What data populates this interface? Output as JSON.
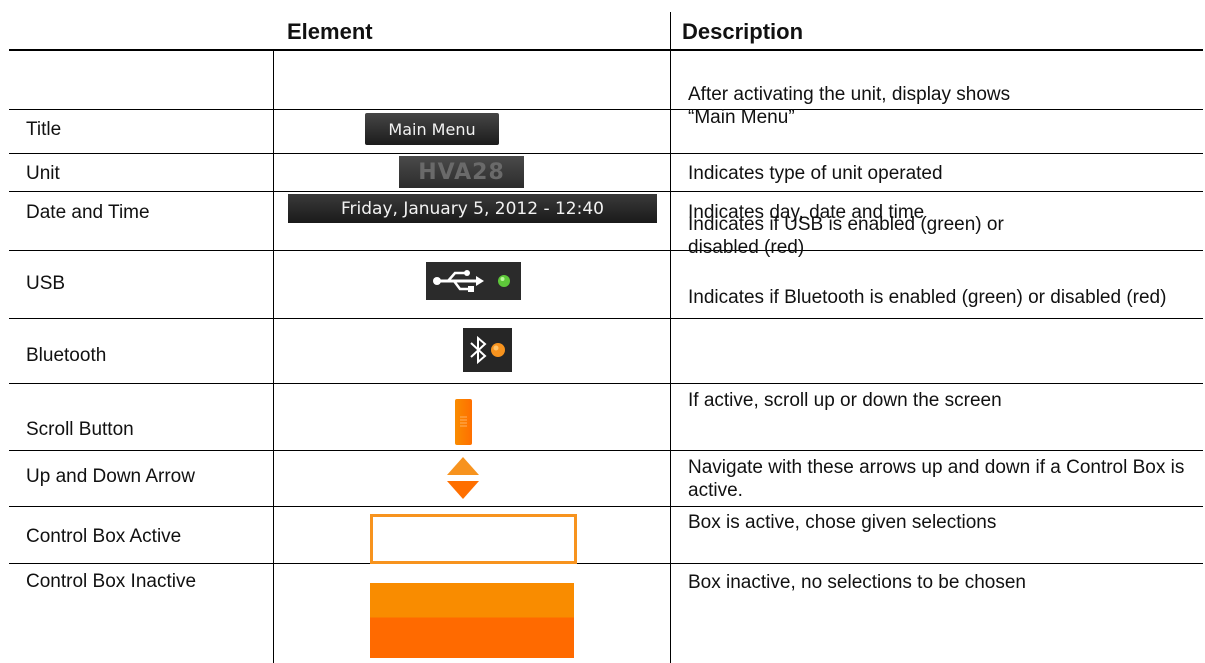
{
  "table": {
    "header": {
      "element": "Element",
      "description": "Description"
    },
    "rows": [
      {
        "element": "Title",
        "description": "After activating the unit, display shows “Main Menu”",
        "icon": "title-bar-icon",
        "icon_text": "Main Menu"
      },
      {
        "element": "Unit",
        "description": "Indicates type of unit operated",
        "icon": "unit-label-icon",
        "icon_text": "HVA28"
      },
      {
        "element": "Date and Time",
        "description": "Indicates day, date and time",
        "icon": "date-time-bar-icon",
        "icon_text": "Friday, January 5, 2012 - 12:40"
      },
      {
        "element": "USB",
        "description": "Indicates if USB is enabled (green) or disabled (red)",
        "icon": "usb-status-icon",
        "status_color": "#5ec83a"
      },
      {
        "element": "Bluetooth",
        "description": "Indicates if Bluetooth  is enabled (green) or disabled (red)",
        "icon": "bluetooth-status-icon",
        "status_color": "#f7931e"
      },
      {
        "element": "Scroll Button",
        "description": "If active, scroll up or down the screen",
        "icon": "scroll-button-icon"
      },
      {
        "element": "Up and Down Arrow",
        "description": "Navigate with these arrows up and down if a Control Box is active.",
        "icon": "up-down-arrow-icon"
      },
      {
        "element": "Control Box Active",
        "description": "Box is active, chose given selections",
        "icon": "control-box-active-icon"
      },
      {
        "element": "Control Box Inactive",
        "description": "Box inactive, no selections to be chosen",
        "icon": "control-box-inactive-icon"
      }
    ]
  },
  "colors": {
    "accent_orange": "#f7931e",
    "dark_orange": "#ff6f00",
    "panel_dark": "#2b2b2b"
  }
}
